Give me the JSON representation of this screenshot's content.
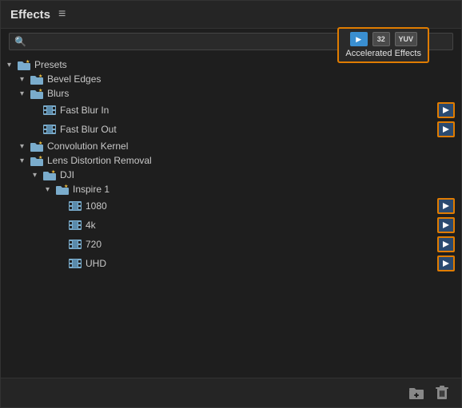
{
  "panel": {
    "title": "Effects",
    "menu_label": "≡"
  },
  "search": {
    "placeholder": ""
  },
  "accelerated_effects": {
    "label": "Accelerated Effects",
    "icon_32": "32",
    "icon_yuv": "YUV"
  },
  "tree": {
    "items": [
      {
        "id": "presets",
        "level": 0,
        "label": "Presets",
        "type": "folder-star",
        "chevron": "▾",
        "accel": false
      },
      {
        "id": "bevel-edges",
        "level": 1,
        "label": "Bevel Edges",
        "type": "folder-star",
        "chevron": "▾",
        "accel": false
      },
      {
        "id": "blurs",
        "level": 1,
        "label": "Blurs",
        "type": "folder-star",
        "chevron": "▾",
        "accel": false
      },
      {
        "id": "fast-blur-in",
        "level": 2,
        "label": "Fast Blur In",
        "type": "film",
        "chevron": "",
        "accel": true
      },
      {
        "id": "fast-blur-out",
        "level": 2,
        "label": "Fast Blur Out",
        "type": "film",
        "chevron": "",
        "accel": true
      },
      {
        "id": "convolution",
        "level": 1,
        "label": "Convolution Kernel",
        "type": "folder-star",
        "chevron": "▾",
        "accel": false
      },
      {
        "id": "lens-distortion",
        "level": 1,
        "label": "Lens Distortion Removal",
        "type": "folder-star",
        "chevron": "▾",
        "accel": false
      },
      {
        "id": "dji",
        "level": 2,
        "label": "DJI",
        "type": "folder-star",
        "chevron": "▾",
        "accel": false
      },
      {
        "id": "inspire1",
        "level": 3,
        "label": "Inspire 1",
        "type": "folder-star",
        "chevron": "▾",
        "accel": false
      },
      {
        "id": "p1080",
        "level": 4,
        "label": "1080",
        "type": "film",
        "chevron": "",
        "accel": true
      },
      {
        "id": "p4k",
        "level": 4,
        "label": "4k",
        "type": "film",
        "chevron": "",
        "accel": true
      },
      {
        "id": "p720",
        "level": 4,
        "label": "720",
        "type": "film",
        "chevron": "",
        "accel": true
      },
      {
        "id": "puhd",
        "level": 4,
        "label": "UHD",
        "type": "film",
        "chevron": "",
        "accel": true
      }
    ]
  },
  "footer": {
    "folder_icon_label": "new-folder",
    "trash_icon_label": "delete"
  }
}
